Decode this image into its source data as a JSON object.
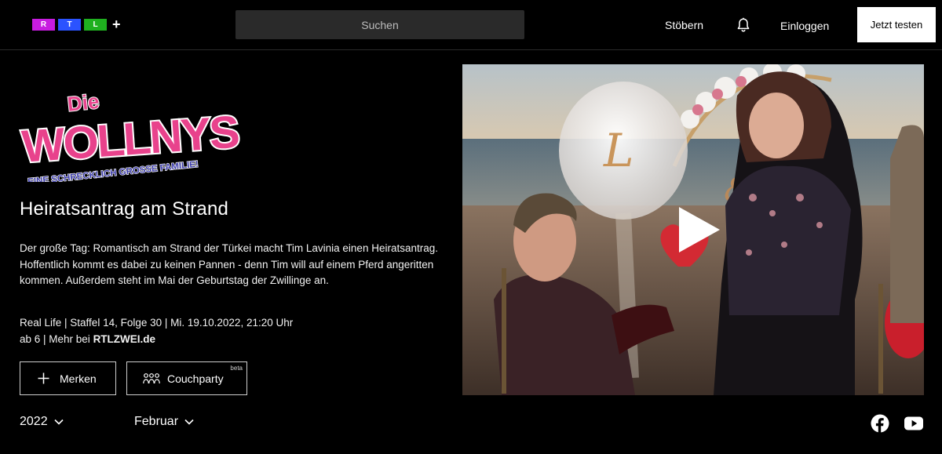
{
  "header": {
    "logo": {
      "letters": [
        "R",
        "T",
        "L"
      ],
      "plus": "+",
      "colors": [
        "#c81ce0",
        "#2b53ff",
        "#1fb01f"
      ]
    },
    "search_placeholder": "Suchen",
    "browse_label": "Stöbern",
    "bell_icon": "bell-icon",
    "login_label": "Einloggen",
    "trial_label": "Jetzt testen"
  },
  "show": {
    "logo_text_top": "Die",
    "logo_text_main": "WOLLNYS",
    "logo_tagline": "EINE SCHRECKLICH GROSSE FAMILIE!"
  },
  "episode": {
    "title": "Heiratsantrag am Strand",
    "description": "Der große Tag: Romantisch am Strand der Türkei macht Tim Lavinia einen Heiratsantrag. Hoffentlich kommt es dabei zu keinen Pannen - denn Tim will auf einem Pferd angeritten kommen. Außerdem steht im Mai der Geburtstag der Zwillinge an.",
    "meta_line1": "Real Life | Staffel 14, Folge 30 | Mi. 19.10.2022, 21:20 Uhr",
    "meta_line2_prefix": "ab 6 | Mehr bei ",
    "meta_line2_link": "RTLZWEI.de"
  },
  "actions": {
    "merken_label": "Merken",
    "couchparty_label": "Couchparty",
    "couchparty_badge": "beta"
  },
  "filters": {
    "year": "2022",
    "month": "Februar"
  },
  "video": {
    "play_icon": "play-icon",
    "balloon_letter_1": "L",
    "balloon_letter_2": "&"
  },
  "social": {
    "facebook_icon": "facebook-icon",
    "youtube_icon": "youtube-icon"
  }
}
